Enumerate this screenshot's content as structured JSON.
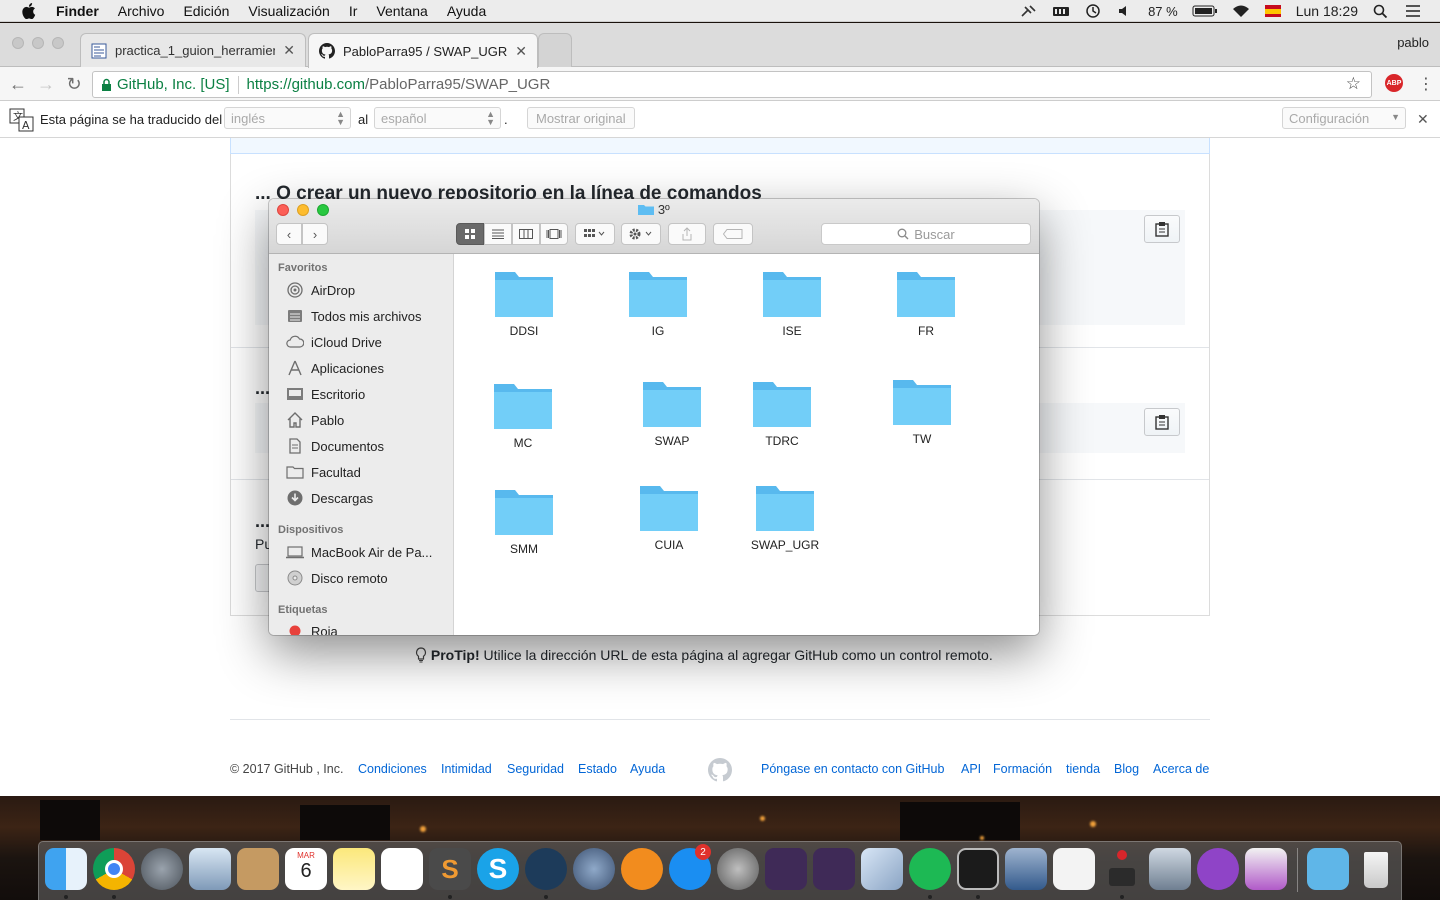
{
  "menubar": {
    "app": "Finder",
    "items": [
      "Archivo",
      "Edición",
      "Visualización",
      "Ir",
      "Ventana",
      "Ayuda"
    ],
    "battery": "87 %",
    "clock": "Lun 18:29"
  },
  "browser": {
    "profile": "pablo",
    "tabs": [
      {
        "title": "practica_1_guion_herramienta",
        "icon": "document-icon"
      },
      {
        "title": "PabloParra95 / SWAP_UGR",
        "icon": "github-icon"
      }
    ],
    "omnibox": {
      "secure_label": "GitHub, Inc. [US]",
      "url_scheme_host": "https://github.com",
      "url_path": "/PabloParra95/SWAP_UGR"
    },
    "abp_label": "ABP"
  },
  "translate": {
    "prefix": "Esta página se ha traducido del",
    "from_lang": "inglés",
    "joiner": "al",
    "to_lang": "español",
    "period": ".",
    "show_original": "Mostrar original",
    "settings": "Configuración"
  },
  "page": {
    "section_title": "... O crear un nuevo repositorio en la línea de comandos",
    "ellipsis_2": "...",
    "ellipsis_3": "...",
    "fragment_pu": "Pu",
    "protip_bold": "ProTip!",
    "protip_text": " Utilice la dirección URL de esta página al agregar GitHub como un control remoto.",
    "footer": {
      "copyright": "© 2017 GitHub , Inc.",
      "links_left": [
        "Condiciones",
        "Intimidad",
        "Seguridad",
        "Estado",
        "Ayuda"
      ],
      "links_right": [
        "Póngase en contacto con GitHub",
        "API",
        "Formación",
        "tienda",
        "Blog",
        "Acerca de"
      ]
    }
  },
  "finder": {
    "title": "3º",
    "search_placeholder": "Buscar",
    "sidebar": {
      "favorites_header": "Favoritos",
      "favorites": [
        {
          "label": "AirDrop",
          "icon": "airdrop-icon"
        },
        {
          "label": "Todos mis archivos",
          "icon": "all-files-icon"
        },
        {
          "label": "iCloud Drive",
          "icon": "cloud-icon"
        },
        {
          "label": "Aplicaciones",
          "icon": "applications-icon"
        },
        {
          "label": "Escritorio",
          "icon": "desktop-icon"
        },
        {
          "label": "Pablo",
          "icon": "home-icon"
        },
        {
          "label": "Documentos",
          "icon": "documents-icon"
        },
        {
          "label": "Facultad",
          "icon": "folder-icon"
        },
        {
          "label": "Descargas",
          "icon": "downloads-icon"
        }
      ],
      "devices_header": "Dispositivos",
      "devices": [
        {
          "label": "MacBook Air de Pa...",
          "icon": "laptop-icon"
        },
        {
          "label": "Disco remoto",
          "icon": "disc-icon"
        }
      ],
      "tags_header": "Etiquetas",
      "tags": [
        {
          "label": "Roja",
          "color": "#e8413b"
        }
      ]
    },
    "folders": [
      "DDSI",
      "IG",
      "ISE",
      "FR",
      "MC",
      "SWAP",
      "TDRC",
      "TW",
      "SMM",
      "CUIA",
      "SWAP_UGR"
    ]
  },
  "dock": {
    "apps": [
      "Finder",
      "Chrome",
      "Launchpad",
      "Preview",
      "Contacts",
      "Calendar",
      "Notes",
      "Reminders",
      "Sublime Text",
      "Skype",
      "Steam",
      "Popcorn",
      "iBooks",
      "App Store",
      "System Preferences",
      "TeXShop",
      "TeXworks",
      "Cube",
      "Spotify",
      "Terminal",
      "VirtualBox",
      "File",
      "Joystick",
      "Photos",
      "GitHub",
      "Screenshot",
      "Downloads",
      "Trash"
    ],
    "calendar_month": "MAR",
    "calendar_day": "6",
    "appstore_badge": "2"
  }
}
